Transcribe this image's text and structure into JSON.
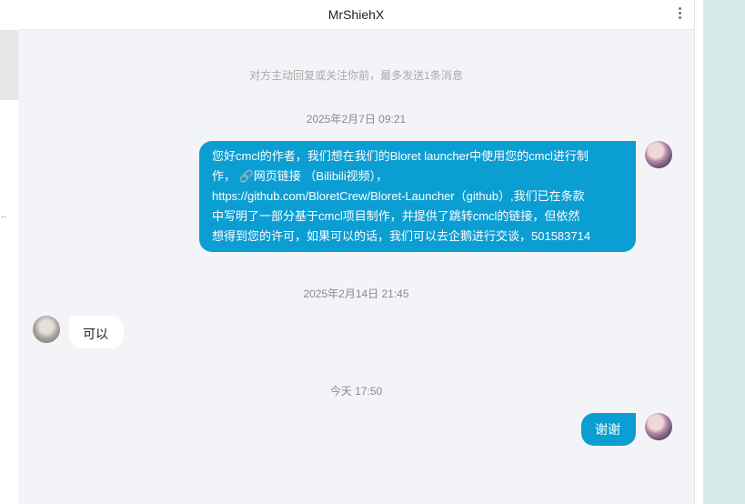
{
  "header": {
    "title": "MrShiehX"
  },
  "notice": "对方主动回复或关注你前，最多发送1条消息",
  "left_strip": {
    "ellipsis": ".."
  },
  "messages": [
    {
      "timestamp": "2025年2月7日 09:21",
      "direction": "out",
      "lines": [
        "您好cmcl的作者，我们想在我们的Bloret launcher中使用您的cmcl进行制",
        "作，  🔗网页链接  （Bilibili视频），",
        "https://github.com/BloretCrew/Bloret-Launcher（github）,我们已在条款",
        "中写明了一部分基于cmcl项目制作，并提供了跳转cmcl的链接，但依然",
        "想得到您的许可，如果可以的话，我们可以去企鹅进行交谈，501583714"
      ]
    },
    {
      "timestamp": "2025年2月14日 21:45",
      "direction": "in",
      "text": "可以"
    },
    {
      "timestamp": "今天 17:50",
      "direction": "out",
      "text": "谢谢"
    }
  ],
  "icons": {
    "more": "more-vertical-icon",
    "avatar_me": "user-avatar",
    "avatar_other": "contact-avatar"
  },
  "colors": {
    "outgoing_bubble": "#0b9ed3",
    "chat_background": "#f3f4f7",
    "side_panel": "#d5ebe8"
  }
}
